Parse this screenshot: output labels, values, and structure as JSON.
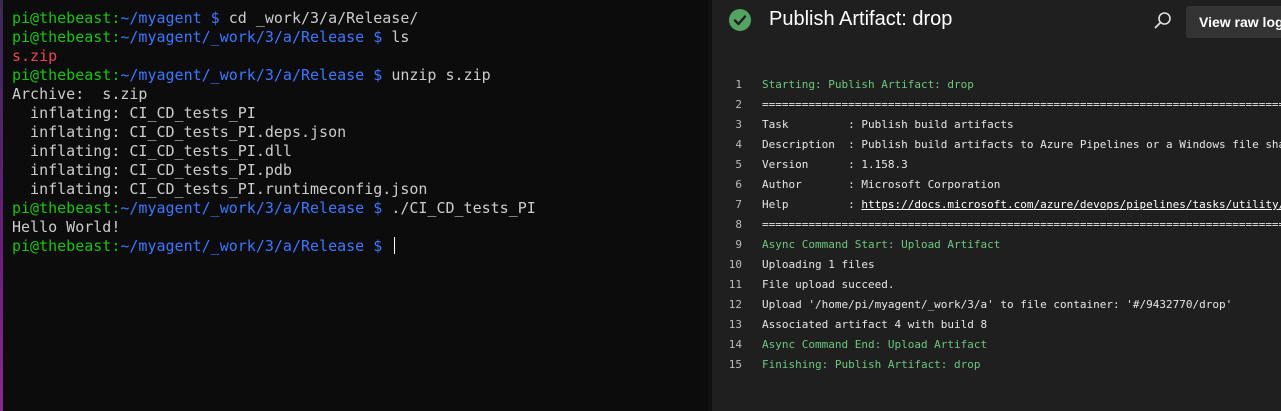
{
  "terminal": {
    "lines": [
      {
        "user": "pi@thebeast",
        "sep": ":",
        "path": "~/myagent",
        "prompt": " $ ",
        "cmd": "cd _work/3/a/Release/"
      },
      {
        "user": "pi@thebeast",
        "sep": ":",
        "path": "~/myagent/_work/3/a/Release",
        "prompt": " $ ",
        "cmd": "ls"
      },
      {
        "text_red": "s.zip"
      },
      {
        "user": "pi@thebeast",
        "sep": ":",
        "path": "~/myagent/_work/3/a/Release",
        "prompt": " $ ",
        "cmd": "unzip s.zip"
      },
      {
        "text": "Archive:  s.zip"
      },
      {
        "text": "  inflating: CI_CD_tests_PI"
      },
      {
        "text": "  inflating: CI_CD_tests_PI.deps.json"
      },
      {
        "text": "  inflating: CI_CD_tests_PI.dll"
      },
      {
        "text": "  inflating: CI_CD_tests_PI.pdb"
      },
      {
        "text": "  inflating: CI_CD_tests_PI.runtimeconfig.json"
      },
      {
        "user": "pi@thebeast",
        "sep": ":",
        "path": "~/myagent/_work/3/a/Release",
        "prompt": " $ ",
        "cmd": "./CI_CD_tests_PI"
      },
      {
        "text": "Hello World!"
      },
      {
        "user": "pi@thebeast",
        "sep": ":",
        "path": "~/myagent/_work/3/a/Release",
        "prompt": " $ ",
        "cmd": "",
        "cursor": true
      }
    ]
  },
  "log": {
    "title": "Publish Artifact: drop",
    "status_icon": "check-circle-icon",
    "status_color": "#55a362",
    "search_icon": "search-icon",
    "view_raw_label": "View raw log",
    "rows": [
      {
        "num": "1",
        "text": "Starting: Publish Artifact: drop",
        "green": true
      },
      {
        "num": "2",
        "text": "======================================================================================"
      },
      {
        "num": "3",
        "text": "Task         : Publish build artifacts"
      },
      {
        "num": "4",
        "text": "Description  : Publish build artifacts to Azure Pipelines or a Windows file share"
      },
      {
        "num": "5",
        "text": "Version      : 1.158.3"
      },
      {
        "num": "6",
        "text": "Author       : Microsoft Corporation"
      },
      {
        "num": "7",
        "text": "Help         : ",
        "link": "https://docs.microsoft.com/azure/devops/pipelines/tasks/utility/publish-build-artifacts"
      },
      {
        "num": "8",
        "text": "======================================================================================"
      },
      {
        "num": "9",
        "text": "Async Command Start: Upload Artifact",
        "green": true
      },
      {
        "num": "10",
        "text": "Uploading 1 files"
      },
      {
        "num": "11",
        "text": "File upload succeed."
      },
      {
        "num": "12",
        "text": "Upload '/home/pi/myagent/_work/3/a' to file container: '#/9432770/drop'"
      },
      {
        "num": "13",
        "text": "Associated artifact 4 with build 8"
      },
      {
        "num": "14",
        "text": "Async Command End: Upload Artifact",
        "green": true
      },
      {
        "num": "15",
        "text": "Finishing: Publish Artifact: drop",
        "green": true
      }
    ]
  },
  "colors": {
    "terminal_bg": "#0c0c0c",
    "prompt_user": "#16c60c",
    "prompt_path": "#3b78ff",
    "error_red": "#e74856",
    "log_bg": "#1f1f1f",
    "log_green": "#6cc77e"
  }
}
